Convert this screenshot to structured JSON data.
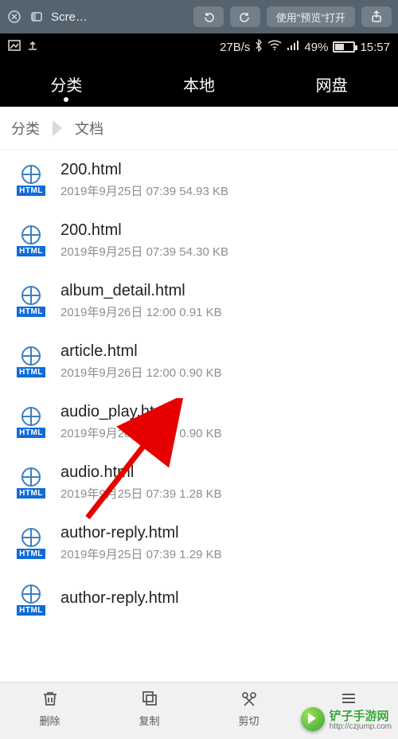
{
  "preview": {
    "title": "Scre…",
    "open_label": "使用\"预览\"打开"
  },
  "status": {
    "speed": "27B/s",
    "battery_pct": "49%",
    "time": "15:57"
  },
  "tabs": {
    "items": [
      {
        "label": "分类",
        "active": true
      },
      {
        "label": "本地",
        "active": false
      },
      {
        "label": "网盘",
        "active": false
      }
    ]
  },
  "breadcrumb": {
    "items": [
      "分类",
      "文档"
    ]
  },
  "files": [
    {
      "name": "200.html",
      "date": "2019年9月25日",
      "time": "07:39",
      "size": "54.93 KB"
    },
    {
      "name": "200.html",
      "date": "2019年9月25日",
      "time": "07:39",
      "size": "54.30 KB"
    },
    {
      "name": "album_detail.html",
      "date": "2019年9月26日",
      "time": "12:00",
      "size": "0.91 KB"
    },
    {
      "name": "article.html",
      "date": "2019年9月26日",
      "time": "12:00",
      "size": "0.90 KB"
    },
    {
      "name": "audio_play.html",
      "date": "2019年9月26日",
      "time": "12:00",
      "size": "0.90 KB"
    },
    {
      "name": "audio.html",
      "date": "2019年9月25日",
      "time": "07:39",
      "size": "1.28 KB"
    },
    {
      "name": "author-reply.html",
      "date": "2019年9月25日",
      "time": "07:39",
      "size": "1.29 KB"
    },
    {
      "name": "author-reply.html",
      "date": "",
      "time": "",
      "size": ""
    }
  ],
  "file_icon_tag": "HTML",
  "bottom": {
    "items": [
      {
        "label": "删除"
      },
      {
        "label": "复制"
      },
      {
        "label": "剪切"
      },
      {
        "label": ""
      }
    ]
  },
  "watermark": {
    "text": "铲子手游网",
    "url": "http://czjump.com"
  }
}
